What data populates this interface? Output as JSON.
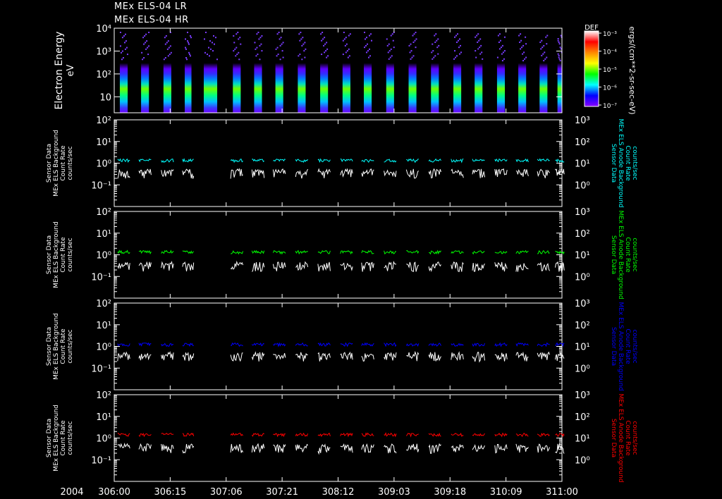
{
  "header": {
    "title_line_1": "MEx ELS-04 LR",
    "title_line_2": "MEx ELS-04 HR"
  },
  "colorbar": {
    "label": "DEF",
    "units": "ergs/(cm**2-sr-sec-eV)",
    "tick_labels": [
      "10⁻³",
      "10⁻⁴",
      "10⁻⁵",
      "10⁻⁶",
      "10⁻⁷"
    ],
    "colors": [
      "#ffffff",
      "#ff0000",
      "#ff8800",
      "#ffff00",
      "#00ff00",
      "#00ffff",
      "#0000ff",
      "#8800ff"
    ]
  },
  "time_axis": {
    "year_label": "2004",
    "tick_labels": [
      "306:00",
      "306:15",
      "307:06",
      "307:21",
      "308:12",
      "309:03",
      "309:18",
      "310:09",
      "311:00"
    ]
  },
  "chart_data": [
    {
      "type": "heatmap",
      "ylabel": "Electron Energy",
      "yunits": "eV",
      "yscale": "log",
      "ylim": [
        2,
        10000
      ],
      "y_tick_labels": [
        "10⁴",
        "10³",
        "10²",
        "10"
      ],
      "colorscale_range": [
        1e-07,
        0.001
      ],
      "data_segments_x": [
        [
          0.5,
          1.2
        ],
        [
          2.4,
          3.1
        ],
        [
          4.4,
          5.1
        ],
        [
          6.3,
          6.9
        ],
        [
          8.0,
          9.2
        ],
        [
          10.6,
          11.3
        ],
        [
          12.5,
          13.2
        ],
        [
          14.4,
          15.1
        ],
        [
          16.4,
          17.1
        ],
        [
          18.4,
          19.1
        ],
        [
          20.4,
          21.1
        ],
        [
          22.3,
          23.0
        ],
        [
          24.3,
          25.0
        ],
        [
          26.3,
          27.0
        ],
        [
          28.3,
          29.0
        ],
        [
          30.3,
          31.0
        ],
        [
          32.2,
          32.9
        ],
        [
          34.2,
          34.9
        ],
        [
          36.1,
          36.8
        ],
        [
          38.0,
          38.7
        ],
        [
          39.6,
          40.0
        ]
      ]
    },
    {
      "type": "line",
      "ylabel": "Sensor Data MEx ELS Background Count Rate counts/sec",
      "right_label": "Sensor Data MEx ELS Anode Background Count Rate counts/sec",
      "right_color": "#00ffff",
      "yscale": "log",
      "ylim": [
        0.01,
        100
      ],
      "y_tick_labels": [
        "10²",
        "10¹",
        "10⁰",
        "10⁻¹"
      ],
      "right_ylim": [
        0.1,
        1000
      ],
      "right_tick_labels": [
        "10³",
        "10²",
        "10¹",
        "10⁰"
      ],
      "series": [
        {
          "color": "#ffffff",
          "level": 0.35
        },
        {
          "color": "#00ffff",
          "level": 1.3
        }
      ]
    },
    {
      "type": "line",
      "ylabel": "Sensor Data MEx ELS Background Count Rate counts/sec",
      "right_label": "Sensor Data MEx ELS Anode Background Count Rate counts/sec",
      "right_color": "#00ff00",
      "yscale": "log",
      "ylim": [
        0.01,
        100
      ],
      "y_tick_labels": [
        "10²",
        "10¹",
        "10⁰",
        "10⁻¹"
      ],
      "right_ylim": [
        0.1,
        1000
      ],
      "right_tick_labels": [
        "10³",
        "10²",
        "10¹",
        "10⁰"
      ],
      "series": [
        {
          "color": "#ffffff",
          "level": 0.3
        },
        {
          "color": "#00ff00",
          "level": 1.3
        }
      ]
    },
    {
      "type": "line",
      "ylabel": "Sensor Data MEx ELS Background Count Rate counts/sec",
      "right_label": "Sensor Data MEx ELS Anode Background Count Rate counts/sec",
      "right_color": "#0000ff",
      "yscale": "log",
      "ylim": [
        0.01,
        100
      ],
      "y_tick_labels": [
        "10²",
        "10¹",
        "10⁰",
        "10⁻¹"
      ],
      "right_ylim": [
        0.1,
        1000
      ],
      "right_tick_labels": [
        "10³",
        "10²",
        "10¹",
        "10⁰"
      ],
      "series": [
        {
          "color": "#ffffff",
          "level": 0.35
        },
        {
          "color": "#0000ff",
          "level": 1.2
        }
      ]
    },
    {
      "type": "line",
      "ylabel": "Sensor Data MEx ELS Background Count Rate counts/sec",
      "right_label": "Sensor Data MEx ELS Anode Background Count Rate counts/sec",
      "right_color": "#ff0000",
      "yscale": "log",
      "ylim": [
        0.01,
        100
      ],
      "y_tick_labels": [
        "10²",
        "10¹",
        "10⁰",
        "10⁻¹"
      ],
      "right_ylim": [
        0.1,
        1000
      ],
      "right_tick_labels": [
        "10³",
        "10²",
        "10¹",
        "10⁰"
      ],
      "series": [
        {
          "color": "#ffffff",
          "level": 0.35
        },
        {
          "color": "#ff0000",
          "level": 1.4
        }
      ]
    }
  ]
}
